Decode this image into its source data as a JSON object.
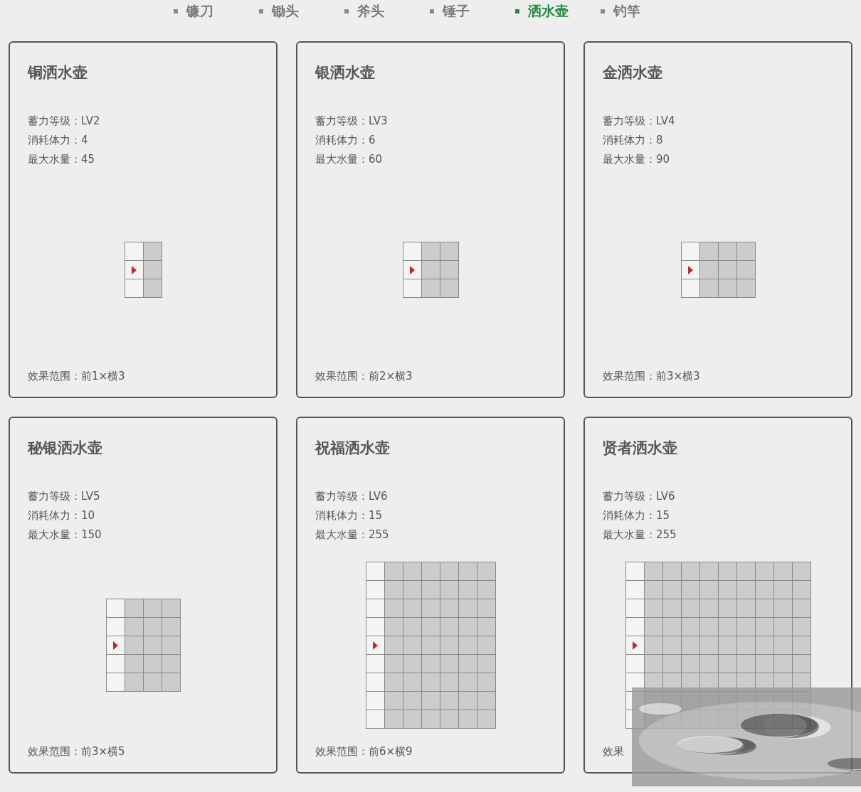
{
  "nav": [
    {
      "label": "镰刀",
      "selected": false
    },
    {
      "label": "锄头",
      "selected": false
    },
    {
      "label": "斧头",
      "selected": false
    },
    {
      "label": "锤子",
      "selected": false
    },
    {
      "label": "洒水壶",
      "selected": true
    },
    {
      "label": "钓竿",
      "selected": false
    }
  ],
  "cards": [
    {
      "title": "铜洒水壶",
      "stats": [
        "蓄力等级：LV2",
        "消耗体力：4",
        "最大水量：45"
      ],
      "grid": [
        [
          {
            "kind": "blank"
          },
          {
            "kind": "effect"
          }
        ],
        [
          {
            "kind": "player"
          },
          {
            "kind": "effect"
          }
        ],
        [
          {
            "kind": "blank"
          },
          {
            "kind": "effect"
          }
        ]
      ],
      "effect": "效果范围：前1×横3"
    },
    {
      "title": "银洒水壶",
      "stats": [
        "蓄力等级：LV3",
        "消耗体力：6",
        "最大水量：60"
      ],
      "grid": [
        [
          {
            "kind": "blank"
          },
          {
            "kind": "effect"
          },
          {
            "kind": "effect"
          }
        ],
        [
          {
            "kind": "player"
          },
          {
            "kind": "effect"
          },
          {
            "kind": "effect"
          }
        ],
        [
          {
            "kind": "blank"
          },
          {
            "kind": "effect"
          },
          {
            "kind": "effect"
          }
        ]
      ],
      "effect": "效果范围：前2×横3"
    },
    {
      "title": "金洒水壶",
      "stats": [
        "蓄力等级：LV4",
        "消耗体力：8",
        "最大水量：90"
      ],
      "grid": [
        [
          {
            "kind": "blank"
          },
          {
            "kind": "effect"
          },
          {
            "kind": "effect"
          },
          {
            "kind": "effect"
          }
        ],
        [
          {
            "kind": "player"
          },
          {
            "kind": "effect"
          },
          {
            "kind": "effect"
          },
          {
            "kind": "effect"
          }
        ],
        [
          {
            "kind": "blank"
          },
          {
            "kind": "effect"
          },
          {
            "kind": "effect"
          },
          {
            "kind": "effect"
          }
        ]
      ],
      "effect": "效果范围：前3×横3"
    },
    {
      "title": "秘银洒水壶",
      "stats": [
        "蓄力等级：LV5",
        "消耗体力：10",
        "最大水量：150"
      ],
      "grid": [
        [
          {
            "kind": "blank"
          },
          {
            "kind": "effect"
          },
          {
            "kind": "effect"
          },
          {
            "kind": "effect"
          }
        ],
        [
          {
            "kind": "blank"
          },
          {
            "kind": "effect"
          },
          {
            "kind": "effect"
          },
          {
            "kind": "effect"
          }
        ],
        [
          {
            "kind": "player"
          },
          {
            "kind": "effect"
          },
          {
            "kind": "effect"
          },
          {
            "kind": "effect"
          }
        ],
        [
          {
            "kind": "blank"
          },
          {
            "kind": "effect"
          },
          {
            "kind": "effect"
          },
          {
            "kind": "effect"
          }
        ],
        [
          {
            "kind": "blank"
          },
          {
            "kind": "effect"
          },
          {
            "kind": "effect"
          },
          {
            "kind": "effect"
          }
        ]
      ],
      "effect": "效果范围：前3×横5"
    },
    {
      "title": "祝福洒水壶",
      "stats": [
        "蓄力等级：LV6",
        "消耗体力：15",
        "最大水量：255"
      ],
      "grid": [
        [
          {
            "kind": "blank"
          },
          {
            "kind": "effect"
          },
          {
            "kind": "effect"
          },
          {
            "kind": "effect"
          },
          {
            "kind": "effect"
          },
          {
            "kind": "effect"
          },
          {
            "kind": "effect"
          }
        ],
        [
          {
            "kind": "blank"
          },
          {
            "kind": "effect"
          },
          {
            "kind": "effect"
          },
          {
            "kind": "effect"
          },
          {
            "kind": "effect"
          },
          {
            "kind": "effect"
          },
          {
            "kind": "effect"
          }
        ],
        [
          {
            "kind": "blank"
          },
          {
            "kind": "effect"
          },
          {
            "kind": "effect"
          },
          {
            "kind": "effect"
          },
          {
            "kind": "effect"
          },
          {
            "kind": "effect"
          },
          {
            "kind": "effect"
          }
        ],
        [
          {
            "kind": "blank"
          },
          {
            "kind": "effect"
          },
          {
            "kind": "effect"
          },
          {
            "kind": "effect"
          },
          {
            "kind": "effect"
          },
          {
            "kind": "effect"
          },
          {
            "kind": "effect"
          }
        ],
        [
          {
            "kind": "player"
          },
          {
            "kind": "effect"
          },
          {
            "kind": "effect"
          },
          {
            "kind": "effect"
          },
          {
            "kind": "effect"
          },
          {
            "kind": "effect"
          },
          {
            "kind": "effect"
          }
        ],
        [
          {
            "kind": "blank"
          },
          {
            "kind": "effect"
          },
          {
            "kind": "effect"
          },
          {
            "kind": "effect"
          },
          {
            "kind": "effect"
          },
          {
            "kind": "effect"
          },
          {
            "kind": "effect"
          }
        ],
        [
          {
            "kind": "blank"
          },
          {
            "kind": "effect"
          },
          {
            "kind": "effect"
          },
          {
            "kind": "effect"
          },
          {
            "kind": "effect"
          },
          {
            "kind": "effect"
          },
          {
            "kind": "effect"
          }
        ],
        [
          {
            "kind": "blank"
          },
          {
            "kind": "effect"
          },
          {
            "kind": "effect"
          },
          {
            "kind": "effect"
          },
          {
            "kind": "effect"
          },
          {
            "kind": "effect"
          },
          {
            "kind": "effect"
          }
        ],
        [
          {
            "kind": "blank"
          },
          {
            "kind": "effect"
          },
          {
            "kind": "effect"
          },
          {
            "kind": "effect"
          },
          {
            "kind": "effect"
          },
          {
            "kind": "effect"
          },
          {
            "kind": "effect"
          }
        ]
      ],
      "effect": "效果范围：前6×横9"
    },
    {
      "title": "贤者洒水壶",
      "stats": [
        "蓄力等级：LV6",
        "消耗体力：15",
        "最大水量：255"
      ],
      "grid": [
        [
          {
            "kind": "blank"
          },
          {
            "kind": "effect"
          },
          {
            "kind": "effect"
          },
          {
            "kind": "effect"
          },
          {
            "kind": "effect"
          },
          {
            "kind": "effect"
          },
          {
            "kind": "effect"
          },
          {
            "kind": "effect"
          },
          {
            "kind": "effect"
          },
          {
            "kind": "effect"
          }
        ],
        [
          {
            "kind": "blank"
          },
          {
            "kind": "effect"
          },
          {
            "kind": "effect"
          },
          {
            "kind": "effect"
          },
          {
            "kind": "effect"
          },
          {
            "kind": "effect"
          },
          {
            "kind": "effect"
          },
          {
            "kind": "effect"
          },
          {
            "kind": "effect"
          },
          {
            "kind": "effect"
          }
        ],
        [
          {
            "kind": "blank"
          },
          {
            "kind": "effect"
          },
          {
            "kind": "effect"
          },
          {
            "kind": "effect"
          },
          {
            "kind": "effect"
          },
          {
            "kind": "effect"
          },
          {
            "kind": "effect"
          },
          {
            "kind": "effect"
          },
          {
            "kind": "effect"
          },
          {
            "kind": "effect"
          }
        ],
        [
          {
            "kind": "blank"
          },
          {
            "kind": "effect"
          },
          {
            "kind": "effect"
          },
          {
            "kind": "effect"
          },
          {
            "kind": "effect"
          },
          {
            "kind": "effect"
          },
          {
            "kind": "effect"
          },
          {
            "kind": "effect"
          },
          {
            "kind": "effect"
          },
          {
            "kind": "effect"
          }
        ],
        [
          {
            "kind": "player"
          },
          {
            "kind": "effect"
          },
          {
            "kind": "effect"
          },
          {
            "kind": "effect"
          },
          {
            "kind": "effect"
          },
          {
            "kind": "effect"
          },
          {
            "kind": "effect"
          },
          {
            "kind": "effect"
          },
          {
            "kind": "effect"
          },
          {
            "kind": "effect"
          }
        ],
        [
          {
            "kind": "blank"
          },
          {
            "kind": "effect"
          },
          {
            "kind": "effect"
          },
          {
            "kind": "effect"
          },
          {
            "kind": "effect"
          },
          {
            "kind": "effect"
          },
          {
            "kind": "effect"
          },
          {
            "kind": "effect"
          },
          {
            "kind": "effect"
          },
          {
            "kind": "effect"
          }
        ],
        [
          {
            "kind": "blank"
          },
          {
            "kind": "effect"
          },
          {
            "kind": "effect"
          },
          {
            "kind": "effect"
          },
          {
            "kind": "effect"
          },
          {
            "kind": "effect"
          },
          {
            "kind": "effect"
          },
          {
            "kind": "effect"
          },
          {
            "kind": "effect"
          },
          {
            "kind": "effect"
          }
        ],
        [
          {
            "kind": "blank"
          },
          {
            "kind": "effect"
          },
          {
            "kind": "effect"
          },
          {
            "kind": "effect"
          },
          {
            "kind": "effect"
          },
          {
            "kind": "effect"
          },
          {
            "kind": "effect"
          },
          {
            "kind": "effect"
          },
          {
            "kind": "effect"
          },
          {
            "kind": "effect"
          }
        ],
        [
          {
            "kind": "blank"
          },
          {
            "kind": "effect"
          },
          {
            "kind": "effect"
          },
          {
            "kind": "effect"
          },
          {
            "kind": "effect"
          },
          {
            "kind": "effect"
          },
          {
            "kind": "effect"
          },
          {
            "kind": "effect"
          },
          {
            "kind": "effect"
          },
          {
            "kind": "effect"
          }
        ]
      ],
      "effect": "效果",
      "covered": true
    }
  ]
}
